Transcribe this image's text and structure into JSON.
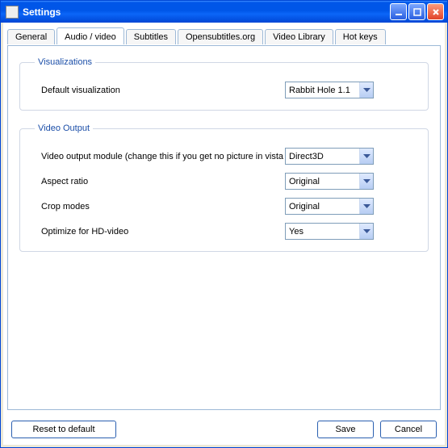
{
  "window": {
    "title": "Settings"
  },
  "tabs": {
    "general": "General",
    "audio_video": "Audio / video",
    "subtitles": "Subtitles",
    "opensubs": "Opensubtitles.org",
    "videolib": "Video Library",
    "hotkeys": "Hot keys"
  },
  "groups": {
    "visualizations": {
      "legend": "Visualizations",
      "default_viz_label": "Default visualization",
      "default_viz_value": "Rabbit Hole 1.1"
    },
    "video_output": {
      "legend": "Video Output",
      "module_label": "Video output module (change this if you get no picture in vista",
      "module_value": "Direct3D",
      "aspect_label": "Aspect ratio",
      "aspect_value": "Original",
      "crop_label": "Crop modes",
      "crop_value": "Original",
      "hd_label": "Optimize for HD-video",
      "hd_value": "Yes"
    }
  },
  "buttons": {
    "reset": "Reset to default",
    "save": "Save",
    "cancel": "Cancel"
  }
}
